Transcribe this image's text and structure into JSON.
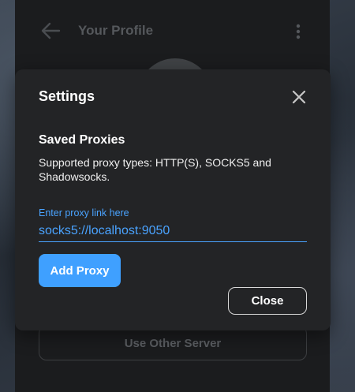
{
  "profile": {
    "title": "Your Profile",
    "other_server_label": "Use Other Server"
  },
  "dialog": {
    "title": "Settings",
    "section_heading": "Saved Proxies",
    "section_description": "Supported proxy types: HTTP(S), SOCKS5 and Shadowsocks.",
    "field_label": "Enter proxy link here",
    "proxy_value": "socks5://localhost:9050",
    "add_button_label": "Add Proxy",
    "close_button_label": "Close"
  },
  "colors": {
    "accent": "#3fa0ff",
    "dialog_bg": "#232426",
    "panel_bg": "#1b1c1e"
  },
  "icons": [
    "back-arrow-icon",
    "more-vertical-icon",
    "close-icon"
  ]
}
